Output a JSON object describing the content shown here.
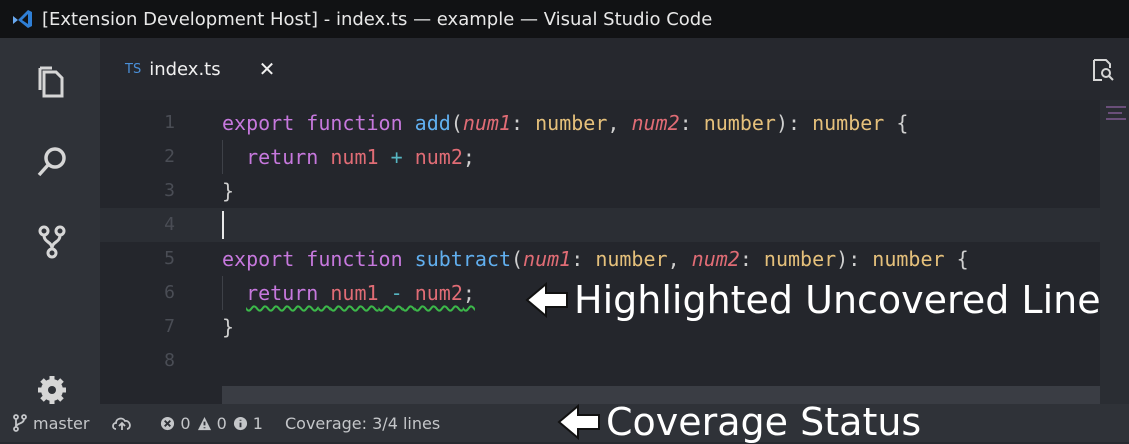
{
  "window": {
    "title": "[Extension Development Host] - index.ts — example — Visual Studio Code"
  },
  "tab": {
    "lang_badge": "TS",
    "filename": "index.ts",
    "close_symbol": "✕"
  },
  "code": {
    "line_numbers": [
      "1",
      "2",
      "3",
      "4",
      "5",
      "6",
      "7",
      "8"
    ],
    "line1": {
      "kw1": "export",
      "kw2": "function",
      "fn": "add",
      "p1": "num1",
      "t1": "number",
      "p2": "num2",
      "t2": "number",
      "rt": "number"
    },
    "line2": {
      "kw": "return",
      "a": "num1",
      "op": "+",
      "b": "num2"
    },
    "line3": "}",
    "line5": {
      "kw1": "export",
      "kw2": "function",
      "fn": "subtract",
      "p1": "num1",
      "t1": "number",
      "p2": "num2",
      "t2": "number",
      "rt": "number"
    },
    "line6": {
      "kw": "return",
      "a": "num1",
      "op": "-",
      "b": "num2"
    },
    "line7": "}"
  },
  "annotations": {
    "uncovered": "Highlighted Uncovered Line",
    "status": "Coverage Status"
  },
  "statusbar": {
    "branch": "master",
    "errors": "0",
    "warnings": "0",
    "infos": "1",
    "coverage": "Coverage: 3/4 lines"
  },
  "colors": {
    "accent": "#4a8fd8",
    "uncovered_underline": "#3cb94a"
  }
}
